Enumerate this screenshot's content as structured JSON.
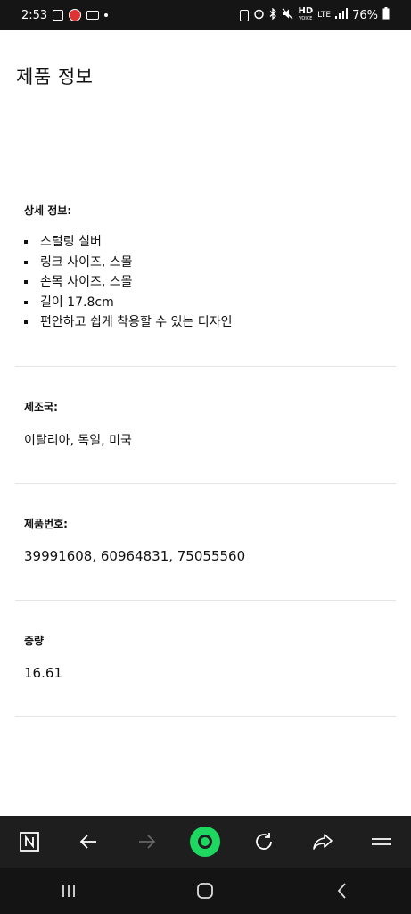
{
  "status_bar": {
    "time": "2:53",
    "battery": "76%",
    "hd_label": "HD",
    "voice_label": "VOICE",
    "network": "LTE"
  },
  "page": {
    "title": "제품 정보"
  },
  "details": {
    "title": "상세 정보:",
    "items": [
      "스털링 실버",
      "링크 사이즈, 스몰",
      "손목 사이즈, 스몰",
      "길이 17.8cm",
      "편안하고 쉽게 착용할 수 있는 디자인"
    ]
  },
  "origin": {
    "title": "제조국:",
    "value": "이탈리아, 독일, 미국"
  },
  "product_number": {
    "title": "제품번호:",
    "value": "39991608, 60964831, 75055560"
  },
  "weight": {
    "title": "중량",
    "value": "16.61"
  },
  "colors": {
    "accent": "#1ed760",
    "toolbar_bg": "#1e1e1e",
    "status_bg": "#151515"
  },
  "toolbar_icons": [
    "naver-n-icon",
    "back-arrow-icon",
    "forward-arrow-icon",
    "green-dot-icon",
    "reload-icon",
    "share-icon",
    "menu-icon"
  ],
  "nav_icons": [
    "recent-apps-icon",
    "home-icon",
    "back-icon"
  ]
}
